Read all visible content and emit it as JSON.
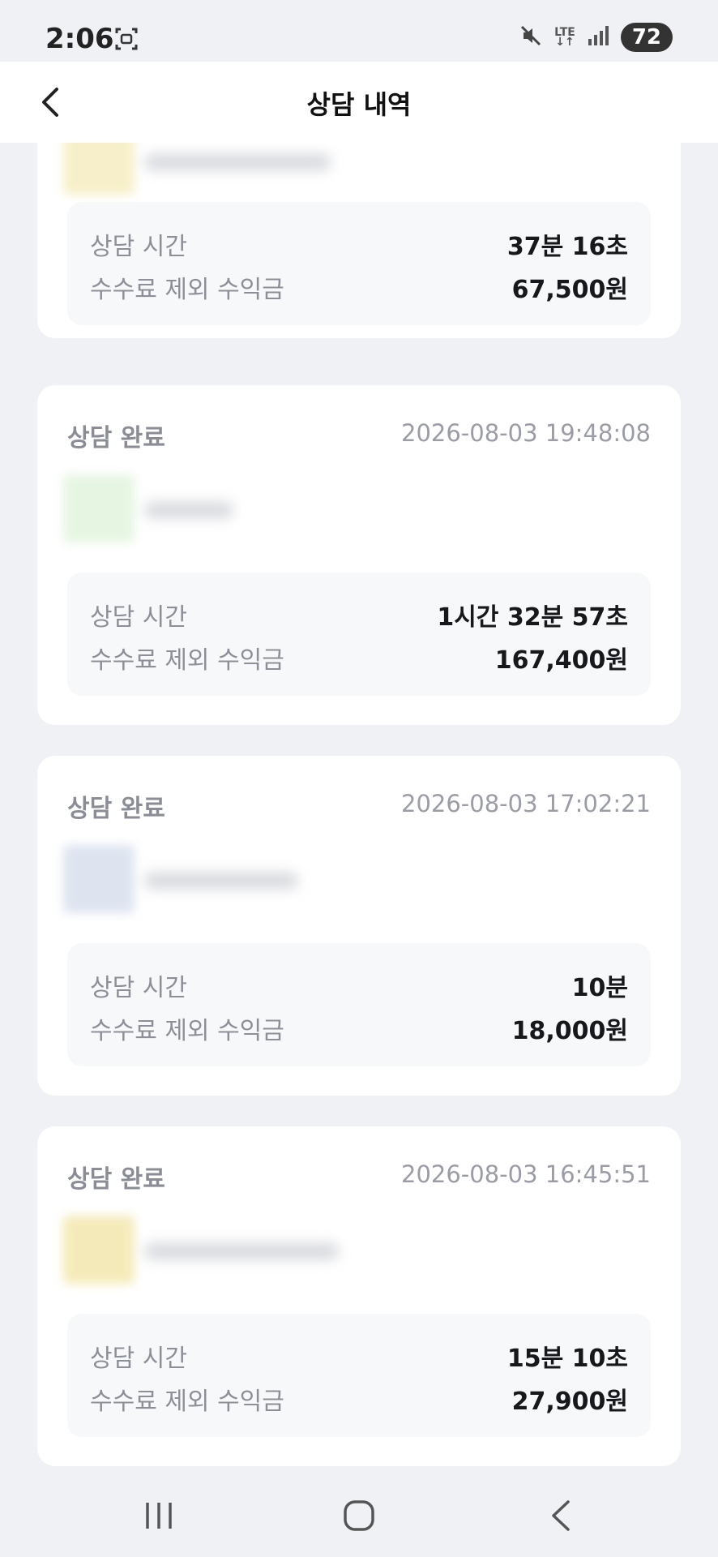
{
  "status_bar": {
    "time": "2:06",
    "network": "LTE",
    "battery": "72",
    "icons": [
      "screenshot-icon",
      "mute-icon",
      "lte-icon",
      "signal-icon",
      "battery-icon"
    ]
  },
  "header": {
    "title": "상담 내역",
    "back_icon": "chevron-left-icon"
  },
  "records": [
    {
      "status": "",
      "datetime": "",
      "duration_label": "상담 시간",
      "duration": "37분 16초",
      "earnings_label": "수수료 제외 수익금",
      "earnings": "67,500원",
      "avatar_color": "#f1e6a6"
    },
    {
      "status": "상담 완료",
      "datetime": "2026-08-03 19:48:08",
      "duration_label": "상담 시간",
      "duration": "1시간 32분 57초",
      "earnings_label": "수수료 제외 수익금",
      "earnings": "167,400원",
      "avatar_color": "#d6efd0"
    },
    {
      "status": "상담 완료",
      "datetime": "2026-08-03 17:02:21",
      "duration_label": "상담 시간",
      "duration": "10분",
      "earnings_label": "수수료 제외 수익금",
      "earnings": "18,000원",
      "avatar_color": "#c8d2e6"
    },
    {
      "status": "상담 완료",
      "datetime": "2026-08-03 16:45:51",
      "duration_label": "상담 시간",
      "duration": "15분 10초",
      "earnings_label": "수수료 제외 수익금",
      "earnings": "27,900원",
      "avatar_color": "#eedd8c"
    }
  ],
  "nav": {
    "recents_icon": "recents-icon",
    "home_icon": "home-icon",
    "back_icon": "back-icon"
  }
}
